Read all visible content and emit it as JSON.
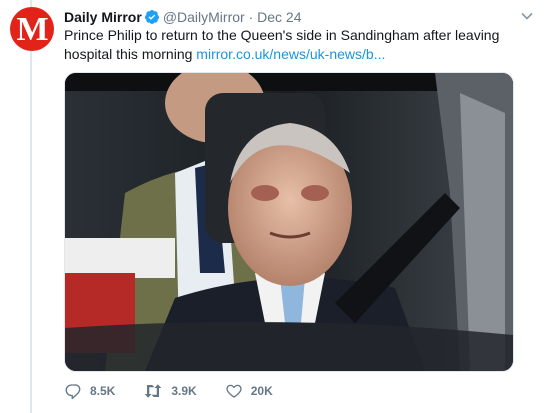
{
  "tweet": {
    "author_name": "Daily Mirror",
    "author_handle": "@DailyMirror",
    "separator": "·",
    "date": "Dec 24",
    "text": "Prince Philip to return to the Queen's side in Sandingham after leaving hospital this morning",
    "link_text": "mirror.co.uk/news/uk-news/b...",
    "avatar_letter": "M"
  },
  "icons": {
    "verified": "verified-badge-icon",
    "menu": "chevron-down-icon",
    "reply": "reply-icon",
    "retweet": "retweet-icon",
    "like": "heart-icon"
  },
  "actions": {
    "replies": "8.5K",
    "retweets": "3.9K",
    "likes": "20K"
  },
  "colors": {
    "brand_red": "#e2231a",
    "link": "#1b95e0",
    "muted": "#657786",
    "verified": "#1da1f2"
  }
}
